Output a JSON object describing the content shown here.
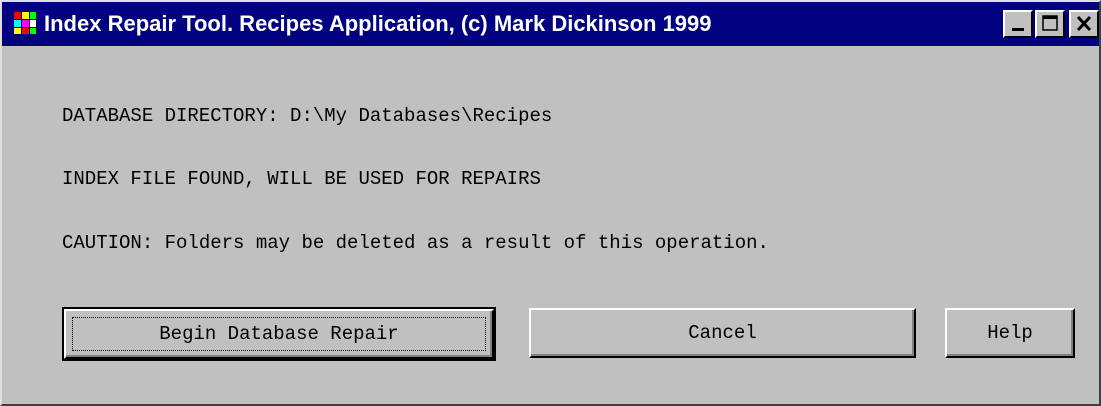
{
  "window": {
    "title": "Index Repair Tool. Recipes Application, (c) Mark Dickinson 1999",
    "icon": "app-icon"
  },
  "controls": {
    "minimize": "minimize-icon",
    "maximize": "maximize-icon",
    "close": "close-icon"
  },
  "content": {
    "directory_line": "DATABASE DIRECTORY: D:\\My Databases\\Recipes",
    "index_line": "INDEX FILE FOUND, WILL BE USED FOR REPAIRS",
    "caution_line": "CAUTION: Folders may be deleted as a result of this operation."
  },
  "buttons": {
    "begin": "Begin Database Repair",
    "cancel": "Cancel",
    "help": "Help"
  },
  "colors": {
    "titlebar": "#000080",
    "face": "#c0c0c0",
    "title_text": "#ffffff"
  }
}
